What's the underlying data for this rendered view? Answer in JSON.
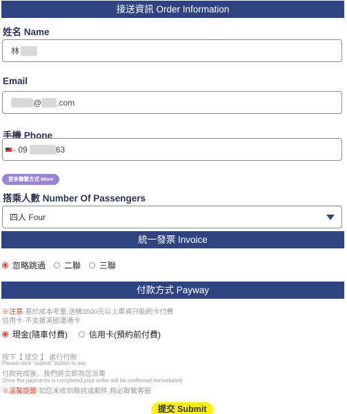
{
  "order_section": {
    "title": "接送資訊 Order Information",
    "name": {
      "label": "姓名 Name",
      "value_prefix": "林"
    },
    "email": {
      "label": "Email",
      "value_middle": "@",
      "value_suffix": ".com"
    },
    "phone": {
      "label": "手機 Phone",
      "prefix": "- 09",
      "suffix": "63"
    },
    "more_button": "更多聯繫方式 More",
    "passengers": {
      "label": "搭乘人數 Number Of Passengers",
      "selected": "四人 Four"
    }
  },
  "invoice_section": {
    "title": "統一發票 Invoice",
    "options": [
      "忽略跳過",
      "二聯",
      "三聯"
    ],
    "selected_index": 0
  },
  "payway_section": {
    "title": "付款方式 Payway",
    "note1_mark": "※注意",
    "note1_text": "-基於成本考量,送機3500元以上車資只能刷卡付費",
    "note2": "信用卡-不支援美國運通卡",
    "options": [
      "現金(隨車付費)",
      "信用卡(預約前付費)"
    ],
    "selected_index": 0
  },
  "instructions": {
    "line1": "按下【 提交 】 進行付款",
    "line2": "Please click \"submit\" button to pay",
    "line3": "付款完成後，我們將立即為您派車",
    "line4": "Once the payments is completed,your order will be confirmed immediately",
    "line5_mark": "※溫馨提醒",
    "line5_text": "-如您未收到簡訊或郵件,務必聯繫客服"
  },
  "submit_label": "提交 Submit",
  "colors": {
    "header": "#2f4380",
    "accent_red": "#e23b2e",
    "submit": "#fff200",
    "more_button": "#9b84d6"
  },
  "icons": {
    "flag": "taiwan-flag-icon",
    "select_arrow": "triangle-down-icon"
  }
}
